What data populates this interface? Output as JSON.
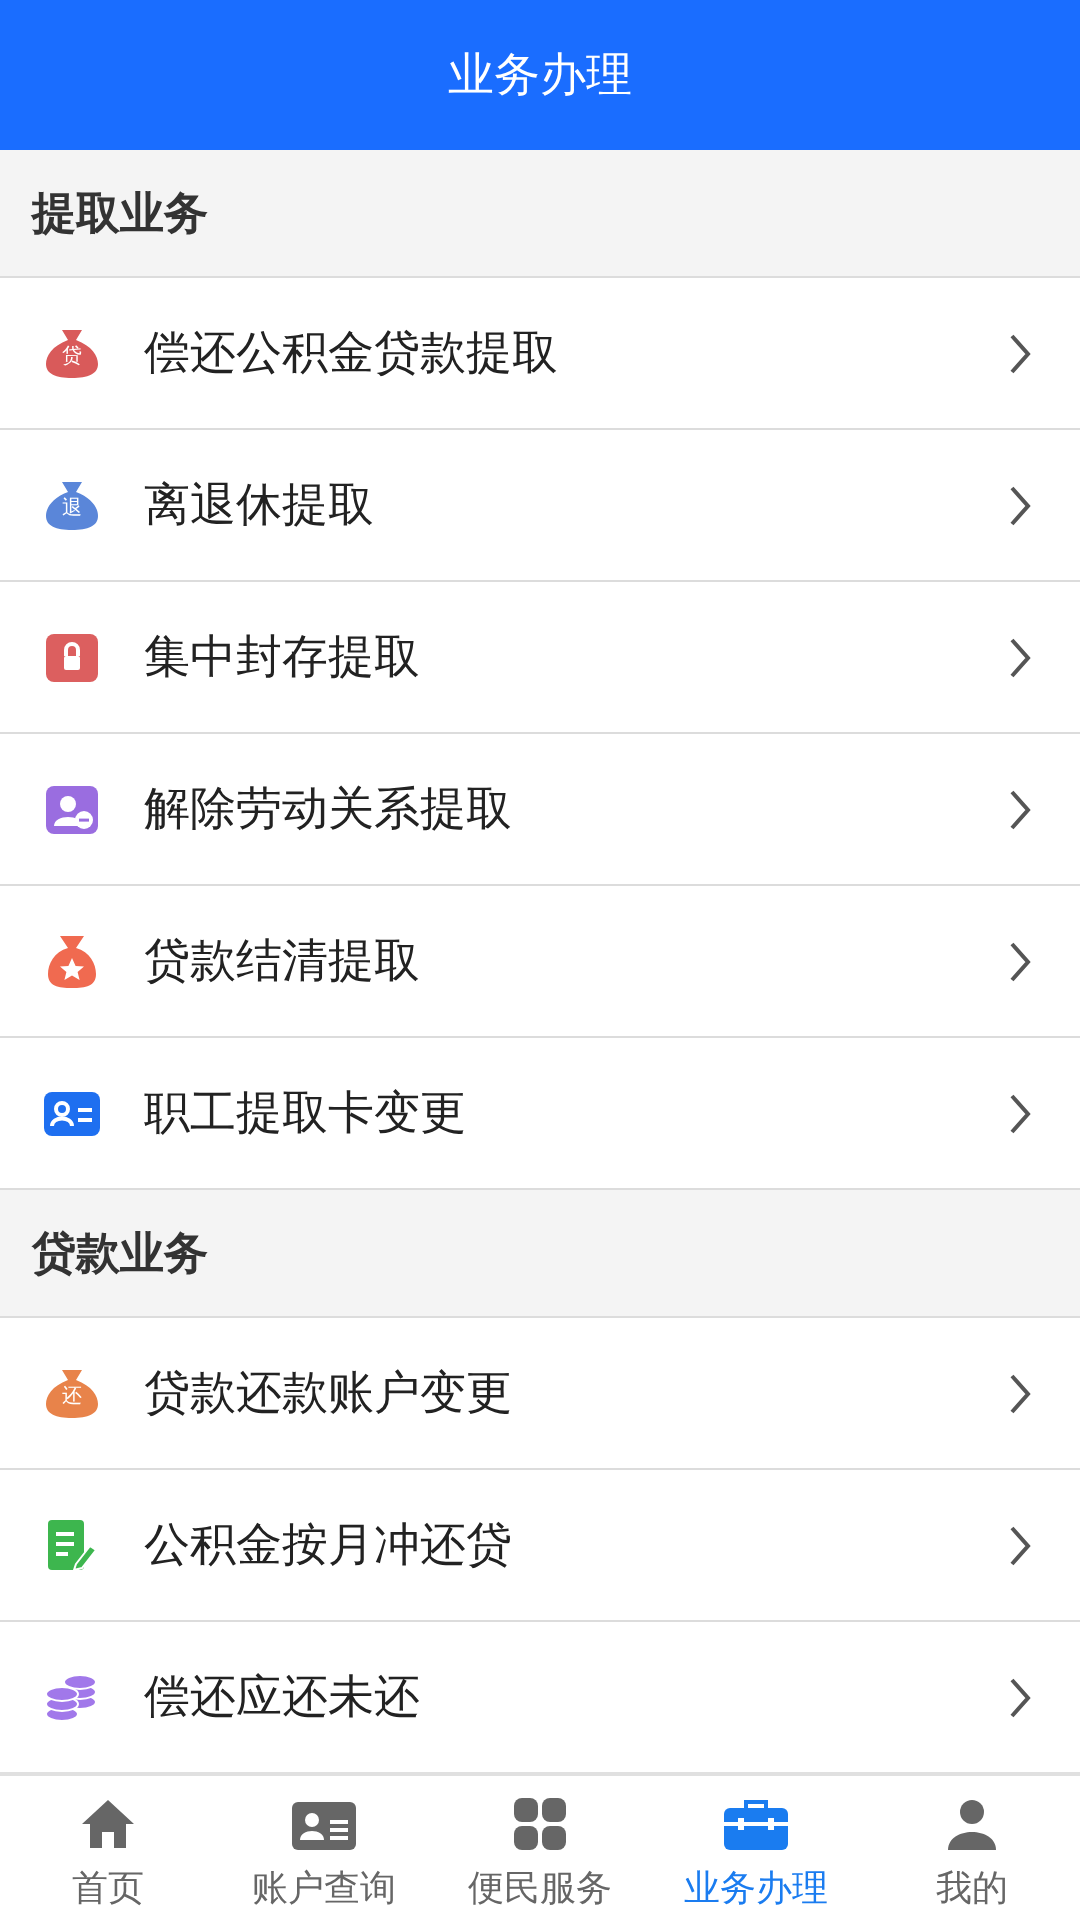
{
  "header": {
    "title": "业务办理"
  },
  "sections": [
    {
      "title": "提取业务",
      "items": [
        {
          "label": "偿还公积金贷款提取",
          "kind": "bag",
          "color": "#d95a5a",
          "glyph": "贷"
        },
        {
          "label": "离退休提取",
          "kind": "bag",
          "color": "#5a86d9",
          "glyph": "退"
        },
        {
          "label": "集中封存提取",
          "kind": "lock",
          "color": "#dc5f5f"
        },
        {
          "label": "解除劳动关系提取",
          "kind": "person",
          "color": "#9a6de0"
        },
        {
          "label": "贷款结清提取",
          "kind": "star",
          "color": "#f06a50"
        },
        {
          "label": "职工提取卡变更",
          "kind": "card",
          "color": "#1e6ff0"
        }
      ]
    },
    {
      "title": "贷款业务",
      "items": [
        {
          "label": "贷款还款账户变更",
          "kind": "bag",
          "color": "#e8834a",
          "glyph": "还"
        },
        {
          "label": "公积金按月冲还贷",
          "kind": "doc",
          "color": "#3db64e"
        },
        {
          "label": "偿还应还未还",
          "kind": "coins",
          "color": "#a178ea"
        }
      ]
    }
  ],
  "tabbar": [
    {
      "label": "首页",
      "kind": "home",
      "selected": false
    },
    {
      "label": "账户查询",
      "kind": "card",
      "selected": false
    },
    {
      "label": "便民服务",
      "kind": "grid",
      "selected": false
    },
    {
      "label": "业务办理",
      "kind": "case",
      "selected": true
    },
    {
      "label": "我的",
      "kind": "person",
      "selected": false
    }
  ]
}
